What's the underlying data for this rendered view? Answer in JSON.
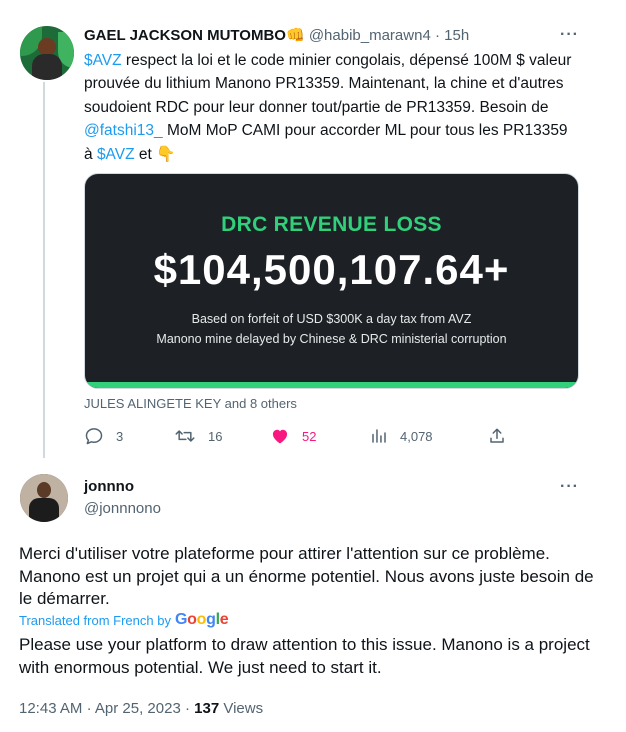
{
  "tweet1": {
    "name": "GAEL JACKSON MUTOMBO",
    "name_emoji": "👊",
    "handle": "@habib_marawn4",
    "dot": "·",
    "time": "15h",
    "text_parts": {
      "p1": "$AVZ",
      "p2": " respect la loi  et le code minier congolais, dépensé 100M $ valeur prouvée du lithium Manono PR13359. Maintenant, la chine et d'autres soudoient RDC pour leur donner tout/partie de PR13359. Besoin de ",
      "p3": "@fatshi13_",
      "p4": " MoM MoP CAMI pour accorder ML pour tous les PR13359 à ",
      "p5": "$AVZ",
      "p6": " et 👇"
    },
    "card": {
      "title": "DRC REVENUE LOSS",
      "amount": "$104,500,107.64+",
      "line1": "Based on forfeit of USD $300K a day tax from AVZ",
      "line2": "Manono mine delayed by Chinese & DRC ministerial corruption",
      "accent_color": "#31d07a"
    },
    "liked_by": "JULES ALINGETE KEY and 8 others",
    "actions": {
      "replies": "3",
      "retweets": "16",
      "likes": "52",
      "views": "4,078"
    },
    "icons": [
      "reply-icon",
      "retweet-icon",
      "heart-icon",
      "views-icon",
      "share-icon",
      "more-icon"
    ],
    "like_color": "#f91880"
  },
  "tweet2": {
    "name": "jonnno",
    "handle": "@jonnnono",
    "text": "Merci d'utiliser votre plateforme pour attirer l'attention sur ce problème. Manono est un projet qui a un énorme potentiel. Nous avons juste besoin de le démarrer.",
    "translated_label": "Translated from French by",
    "google": {
      "g": "G",
      "o1": "o",
      "o2": "o",
      "g2": "g",
      "l": "l",
      "e": "e"
    },
    "translation": "Please use your platform to draw attention to this issue. Manono is a project with enormous potential. We just need to start it.",
    "time": "12:43 AM",
    "sep": "·",
    "date": "Apr 25, 2023",
    "sep2": "·",
    "views_count": "137",
    "views_label": "Views"
  },
  "more_label": "···",
  "link_color": "#1d9bf0"
}
